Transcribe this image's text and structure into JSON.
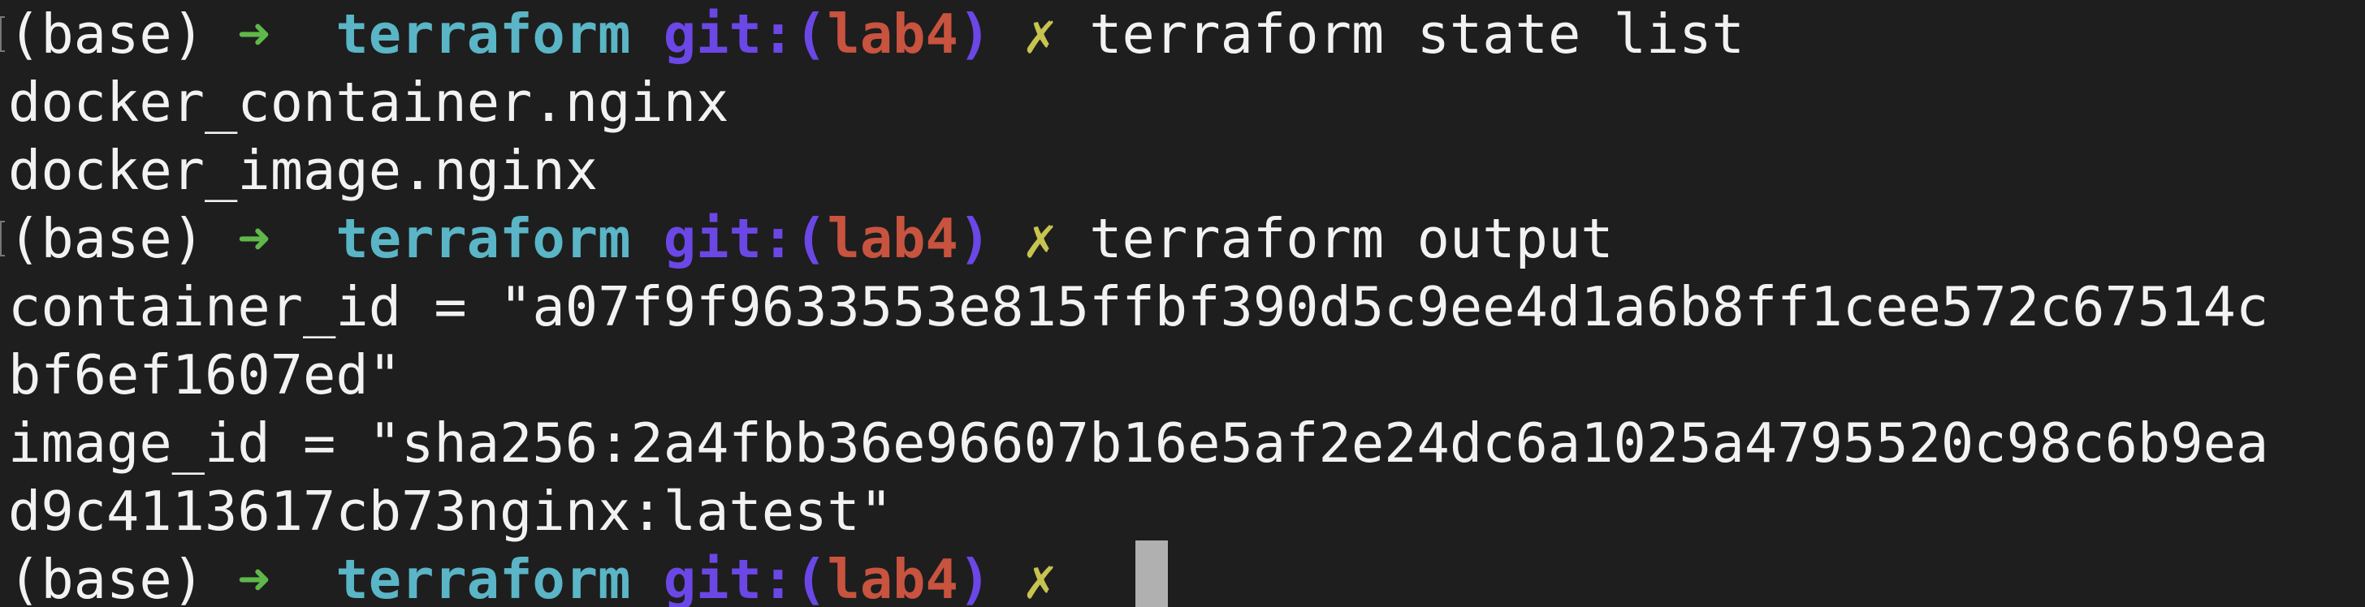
{
  "prompt": {
    "env": "(base)",
    "arrow": "➜",
    "dir": "terraform",
    "git_prefix": "git:(",
    "branch": "lab4",
    "git_suffix": ")",
    "dirty": "✗"
  },
  "lines": [
    {
      "kind": "prompt",
      "command": "terraform state list"
    },
    {
      "kind": "output",
      "text": "docker_container.nginx"
    },
    {
      "kind": "output",
      "text": "docker_image.nginx"
    },
    {
      "kind": "prompt",
      "command": "terraform output"
    },
    {
      "kind": "output",
      "text": "container_id = \"a07f9f9633553e815ffbf390d5c9ee4d1a6b8ff1cee572c67514c"
    },
    {
      "kind": "output",
      "text": "bf6ef1607ed\""
    },
    {
      "kind": "output",
      "text": "image_id = \"sha256:2a4fbb36e96607b16e5af2e24dc6a1025a4795520c98c6b9ea"
    },
    {
      "kind": "output",
      "text": "d9c4113617cb73nginx:latest\""
    },
    {
      "kind": "prompt",
      "command": ""
    }
  ],
  "colors": {
    "background": "#1e1e1e",
    "foreground": "#f2f2f2",
    "arrow": "#5fb84a",
    "dir": "#5ab5c6",
    "git": "#6b47e6",
    "branch": "#c8533f",
    "dirty": "#c6c44f",
    "cursor": "#b0b0b0"
  }
}
